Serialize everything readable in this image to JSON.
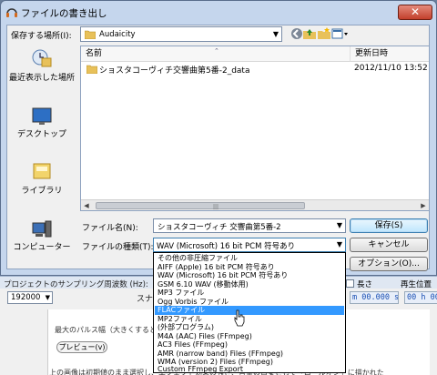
{
  "dialog": {
    "title": "ファイルの書き出し",
    "close_label": "✕",
    "save_in_label": "保存する場所(I):",
    "save_in_value": "Audaicity",
    "places": [
      {
        "label": "最近表示した場所",
        "icon": "recent-places-icon"
      },
      {
        "label": "デスクトップ",
        "icon": "desktop-icon"
      },
      {
        "label": "ライブラリ",
        "icon": "libraries-icon"
      },
      {
        "label": "コンピューター",
        "icon": "computer-icon"
      }
    ],
    "columns": {
      "name": "名前",
      "modified": "更新日時"
    },
    "files": [
      {
        "name": "ショスタコーヴィチ交響曲第5番-2_data",
        "date": "2012/11/10 13:52"
      }
    ],
    "filename_label": "ファイル名(N):",
    "filename_value": "ショスタコーヴィチ 交響曲第5番-2",
    "filetype_label": "ファイルの種類(T):",
    "filetype_value": "WAV (Microsoft) 16 bit PCM 符号あり",
    "save_button": "保存(S)",
    "cancel_button": "キャンセル",
    "options_button": "オプション(O)..."
  },
  "filetype_options": [
    "その他の非圧縮ファイル",
    "AIFF (Apple) 16 bit PCM 符号あり",
    "WAV (Microsoft) 16 bit PCM 符号あり",
    "GSM 6.10 WAV (移動体用)",
    "MP3 ファイル",
    "Ogg Vorbis ファイル",
    "FLACファイル",
    "MP2ファイル",
    "(外部プログラム)",
    "M4A (AAC) Files (FFmpeg)",
    "AC3 Files (FFmpeg)",
    "AMR (narrow band) Files (FFmpeg)",
    "WMA (version 2) Files (FFmpeg)",
    "Custom FFmpeg Export"
  ],
  "filetype_selected_index": 6,
  "background": {
    "rate_label": "プロジェクトのサンプリング周波数 (Hz):",
    "rate_value": "192000",
    "snap_label": "スナ",
    "length_label": "長さ",
    "position_label": "再生位置",
    "time1": "m 00.000 s",
    "time2": "00 h 00",
    "doc_line1": "最大のパルス幅（大きくすると、より",
    "preview_button": "プレビュー(v)",
    "doc_line2": "上の画像は初期値のまま選択し、エフェクト効果の強さ、音量の目安として「ロールオン」に描かれた"
  },
  "colors": {
    "selection": "#3399ff",
    "title_bar": "#c5d6ed",
    "close_button": "#c2402c"
  }
}
